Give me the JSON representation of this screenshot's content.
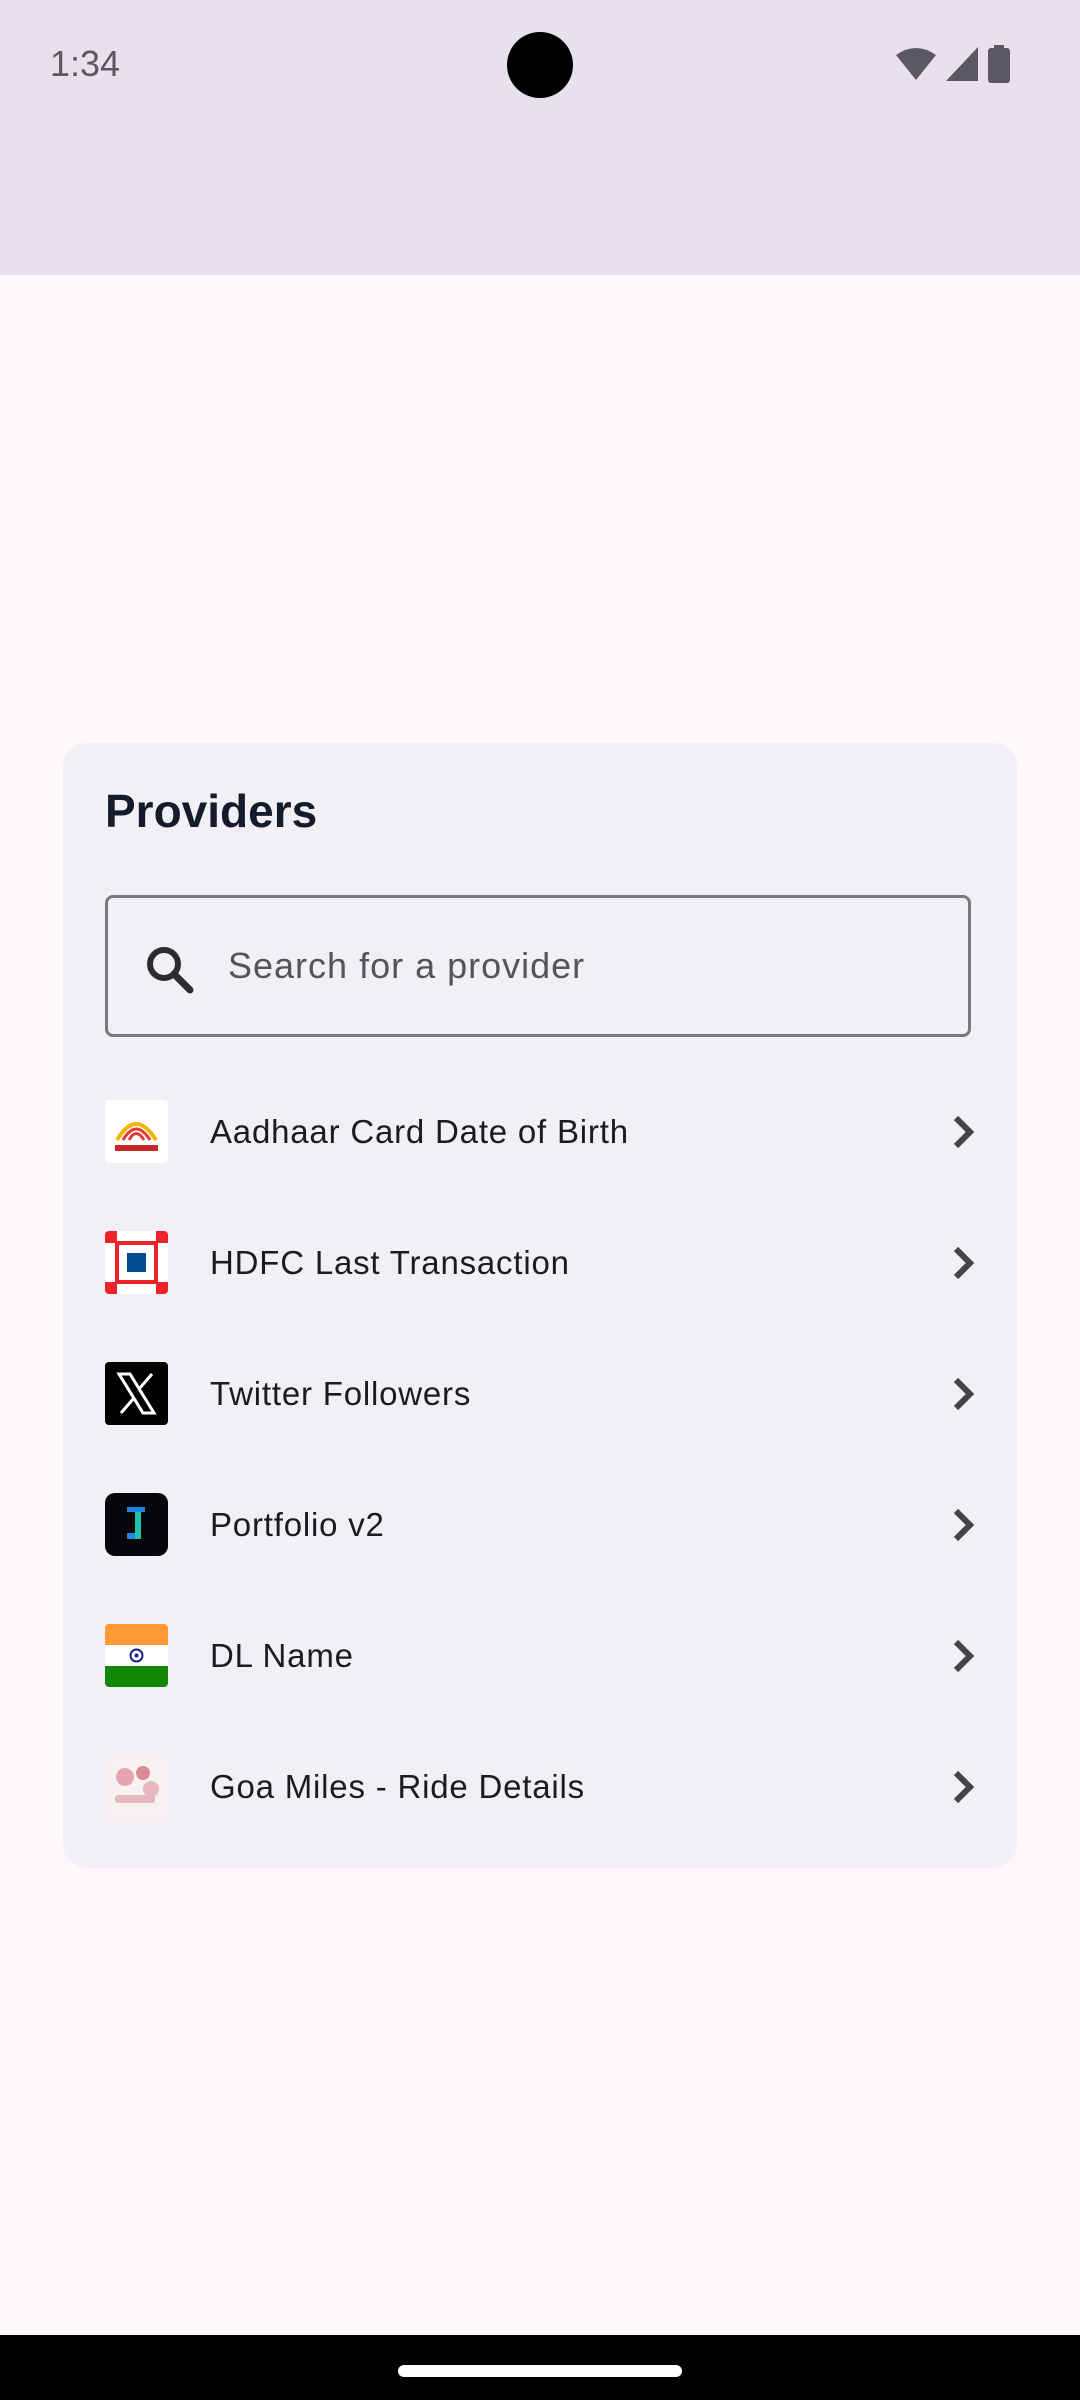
{
  "status_bar": {
    "time": "1:34",
    "icons": [
      "wifi-icon",
      "cellular-signal-icon",
      "battery-icon"
    ]
  },
  "providers_card": {
    "title": "Providers",
    "search": {
      "placeholder": "Search for a provider",
      "value": ""
    },
    "items": [
      {
        "name": "Aadhaar Card Date of Birth",
        "icon": "aadhaar-logo-icon"
      },
      {
        "name": "HDFC Last Transaction",
        "icon": "hdfc-logo-icon"
      },
      {
        "name": "Twitter Followers",
        "icon": "x-logo-icon"
      },
      {
        "name": "Portfolio v2",
        "icon": "portfolio-logo-icon"
      },
      {
        "name": "DL Name",
        "icon": "india-flag-icon"
      },
      {
        "name": "Goa Miles - Ride Details",
        "icon": "goa-miles-logo-icon"
      }
    ]
  },
  "colors": {
    "status_bar_bg": "#e7e0ee",
    "page_bg": "#fdf7fc",
    "card_bg": "#f2f0f5",
    "title_text": "#141b2c",
    "hdfc_red": "#ed232a",
    "hdfc_blue": "#004c8f",
    "india_saffron": "#ff9933",
    "india_green": "#138808"
  }
}
